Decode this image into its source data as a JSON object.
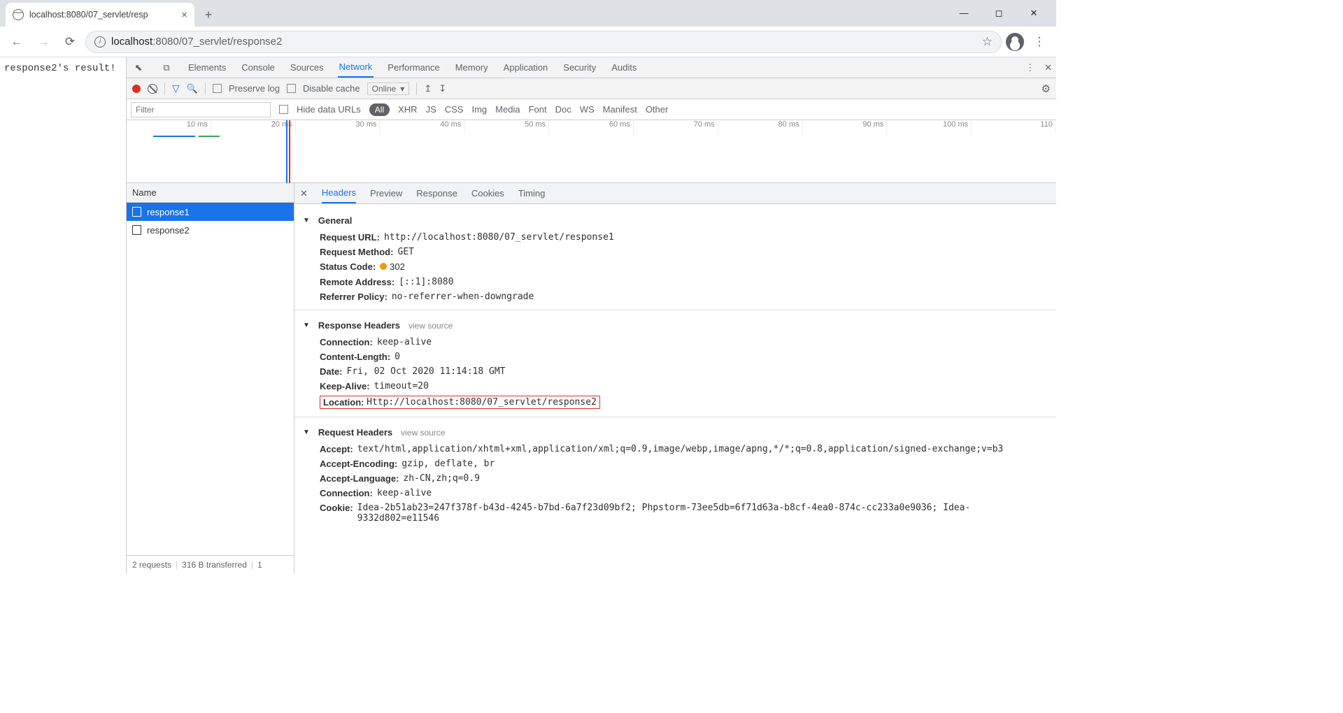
{
  "tab": {
    "title": "localhost:8080/07_servlet/resp"
  },
  "url": {
    "host": "localhost",
    "port": ":8080",
    "path": "/07_servlet/response2"
  },
  "page_text": "response2's result!",
  "devtools": {
    "tabs": [
      "Elements",
      "Console",
      "Sources",
      "Network",
      "Performance",
      "Memory",
      "Application",
      "Security",
      "Audits"
    ],
    "active_tab": "Network",
    "toolbar": {
      "preserve": "Preserve log",
      "disable": "Disable cache",
      "online": "Online"
    },
    "filter": {
      "placeholder": "Filter",
      "hide": "Hide data URLs",
      "types": [
        "All",
        "XHR",
        "JS",
        "CSS",
        "Img",
        "Media",
        "Font",
        "Doc",
        "WS",
        "Manifest",
        "Other"
      ]
    },
    "ticks": [
      "10 ms",
      "20 ms",
      "30 ms",
      "40 ms",
      "50 ms",
      "60 ms",
      "70 ms",
      "80 ms",
      "90 ms",
      "100 ms",
      "110"
    ],
    "reqlist": {
      "header": "Name",
      "items": [
        "response1",
        "response2"
      ],
      "footer_requests": "2 requests",
      "footer_transfer": "316 B transferred",
      "footer_extra": "1"
    },
    "detail_tabs": [
      "Headers",
      "Preview",
      "Response",
      "Cookies",
      "Timing"
    ],
    "general": {
      "title": "General",
      "url_k": "Request URL:",
      "url_v": "http://localhost:8080/07_servlet/response1",
      "method_k": "Request Method:",
      "method_v": "GET",
      "status_k": "Status Code:",
      "status_v": "302",
      "remote_k": "Remote Address:",
      "remote_v": "[::1]:8080",
      "ref_k": "Referrer Policy:",
      "ref_v": "no-referrer-when-downgrade"
    },
    "resp": {
      "title": "Response Headers",
      "vs": "view source",
      "conn_k": "Connection:",
      "conn_v": "keep-alive",
      "cl_k": "Content-Length:",
      "cl_v": "0",
      "date_k": "Date:",
      "date_v": "Fri, 02 Oct 2020 11:14:18 GMT",
      "ka_k": "Keep-Alive:",
      "ka_v": "timeout=20",
      "loc_k": "Location:",
      "loc_v": "Http://localhost:8080/07_servlet/response2"
    },
    "req": {
      "title": "Request Headers",
      "vs": "view source",
      "acc_k": "Accept:",
      "acc_v": "text/html,application/xhtml+xml,application/xml;q=0.9,image/webp,image/apng,*/*;q=0.8,application/signed-exchange;v=b3",
      "ae_k": "Accept-Encoding:",
      "ae_v": "gzip, deflate, br",
      "al_k": "Accept-Language:",
      "al_v": "zh-CN,zh;q=0.9",
      "conn_k": "Connection:",
      "conn_v": "keep-alive",
      "cook_k": "Cookie:",
      "cook_v": "Idea-2b51ab23=247f378f-b43d-4245-b7bd-6a7f23d09bf2; Phpstorm-73ee5db=6f71d63a-b8cf-4ea0-874c-cc233a0e9036; Idea-9332d802=e11546"
    }
  }
}
